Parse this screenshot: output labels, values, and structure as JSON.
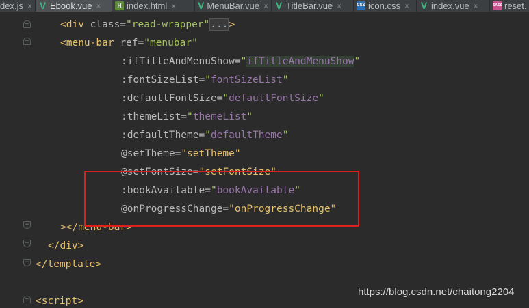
{
  "tabs": [
    {
      "label": "dex.js",
      "icon": "js-icon",
      "active": false
    },
    {
      "label": "Ebook.vue",
      "icon": "vue-icon",
      "active": true
    },
    {
      "label": "index.html",
      "icon": "html-icon",
      "active": false
    },
    {
      "label": "MenuBar.vue",
      "icon": "vue-icon",
      "active": false
    },
    {
      "label": "TitleBar.vue",
      "icon": "vue-icon",
      "active": false
    },
    {
      "label": "icon.css",
      "icon": "css-icon",
      "active": false
    },
    {
      "label": "index.vue",
      "icon": "vue-icon",
      "active": false
    },
    {
      "label": "reset.",
      "icon": "sass-icon",
      "active": false
    }
  ],
  "code": {
    "line1": {
      "open": "<div ",
      "attr": "class=",
      "val": "\"read-wrapper\"",
      "collapsed": "...",
      "close": ">"
    },
    "line2": {
      "open": "<menu-bar ",
      "attr": "ref=",
      "val": "\"menubar\""
    },
    "line3": {
      "attr": ":ifTitleAndMenuShow=",
      "q1": "\"",
      "val": "ifTitleAndMenuShow",
      "q2": "\""
    },
    "line4": {
      "attr": ":fontSizeList=",
      "q1": "\"",
      "val": "fontSizeList",
      "q2": "\""
    },
    "line5": {
      "attr": ":defaultFontSize=",
      "q1": "\"",
      "val": "defaultFontSize",
      "q2": "\""
    },
    "line6": {
      "attr": ":themeList=",
      "q1": "\"",
      "val": "themeList",
      "q2": "\""
    },
    "line7": {
      "attr": ":defaultTheme=",
      "q1": "\"",
      "val": "defaultTheme",
      "q2": "\""
    },
    "line8": {
      "attr": "@setTheme=",
      "val": "\"setTheme\""
    },
    "line9": {
      "attr": "@setFontSize=",
      "val": "\"setFontSize\""
    },
    "line10": {
      "attr": ":bookAvailable=",
      "q1": "\"",
      "val": "bookAvailable",
      "q2": "\""
    },
    "line11": {
      "attr": "@onProgressChange=",
      "val": "\"onProgressChange\""
    },
    "line12": {
      "text": "></menu-bar>"
    },
    "line13": {
      "text": "</div>"
    },
    "line14": {
      "text": "</template>"
    },
    "line15": {
      "text": "<script>"
    }
  },
  "colors": {
    "background": "#2b2b2b",
    "tag": "#e8bf6a",
    "attribute": "#bababa",
    "string": "#a5c261",
    "binding": "#9876aa",
    "highlight_box": "#e0201c"
  },
  "watermark": "https://blog.csdn.net/chaitong2204"
}
